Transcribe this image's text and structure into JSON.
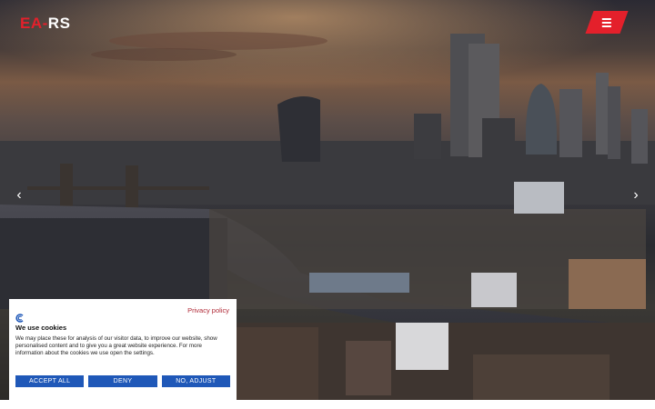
{
  "brand": {
    "part1": "EA",
    "dash": "-",
    "part2": "RS",
    "accent": "#e4202b"
  },
  "header": {
    "menu_icon": "hamburger-icon"
  },
  "carousel": {
    "prev_icon": "chevron-left-icon",
    "next_icon": "chevron-right-icon",
    "prev_glyph": "‹",
    "next_glyph": "›"
  },
  "cookie_banner": {
    "privacy_link": "Privacy policy",
    "title": "We use cookies",
    "body": "We may place these for analysis of our visitor data, to improve our website, show personalised content and to give you a great website experience. For more information about the cookies we use open the settings.",
    "buttons": {
      "accept_all": "ACCEPT ALL",
      "deny": "DENY",
      "adjust": "NO, ADJUST"
    },
    "button_color": "#1f58b8",
    "link_color": "#b02a37"
  }
}
